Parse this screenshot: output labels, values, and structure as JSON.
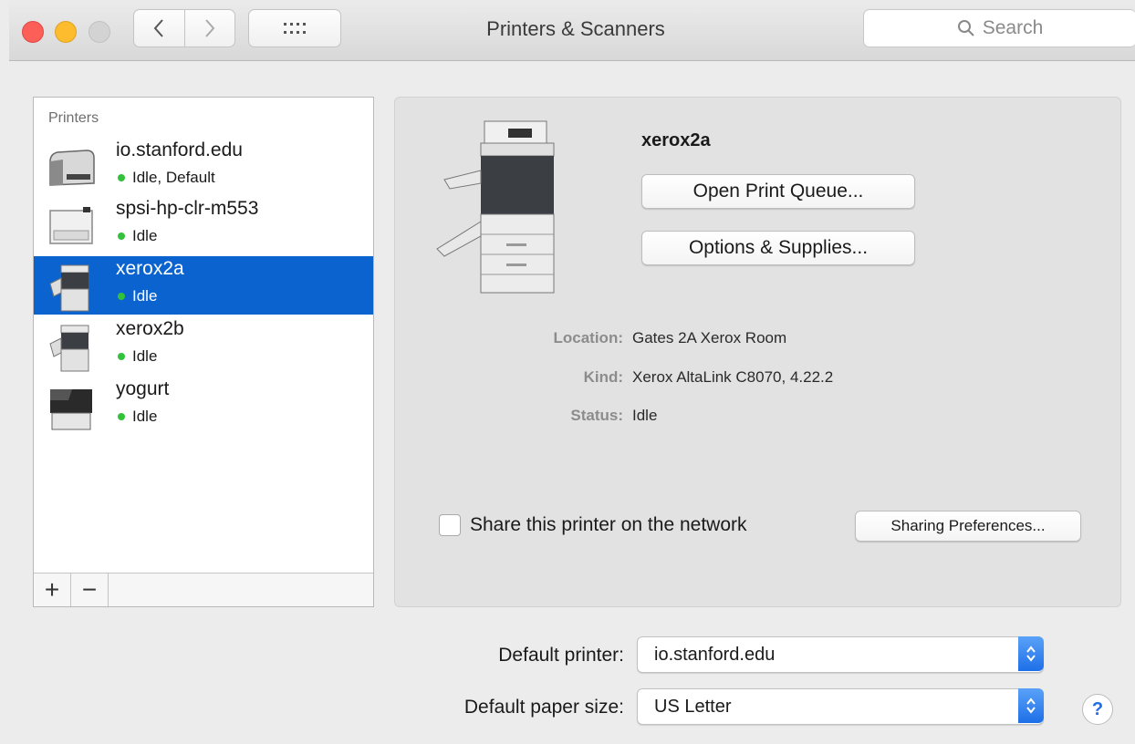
{
  "window": {
    "title": "Printers & Scanners",
    "search_placeholder": "Search"
  },
  "printers_list": {
    "header": "Printers",
    "items": [
      {
        "name": "io.stanford.edu",
        "status": "Idle, Default",
        "icon": "laser-printer-icon"
      },
      {
        "name": "spsi-hp-clr-m553",
        "status": "Idle",
        "icon": "laser-printer-icon"
      },
      {
        "name": "xerox2a",
        "status": "Idle",
        "icon": "copier-printer-icon",
        "selected": true
      },
      {
        "name": "xerox2b",
        "status": "Idle",
        "icon": "copier-printer-icon"
      },
      {
        "name": "yogurt",
        "status": "Idle",
        "icon": "laser-printer-icon"
      }
    ],
    "add_label": "+",
    "remove_label": "−"
  },
  "detail": {
    "name": "xerox2a",
    "open_queue_label": "Open Print Queue...",
    "options_label": "Options & Supplies...",
    "location_label": "Location:",
    "location_value": "Gates 2A Xerox Room",
    "kind_label": "Kind:",
    "kind_value": "Xerox AltaLink C8070, 4.22.2",
    "status_label": "Status:",
    "status_value": "Idle",
    "share_label": "Share this printer on the network",
    "share_checked": false,
    "sharing_prefs_label": "Sharing Preferences..."
  },
  "defaults": {
    "default_printer_label": "Default printer:",
    "default_printer_value": "io.stanford.edu",
    "paper_size_label": "Default paper size:",
    "paper_size_value": "US Letter"
  },
  "help_label": "?",
  "colors": {
    "selection": "#0b63cf",
    "status_dot": "#32c23a",
    "accent": "#1e6fe8"
  }
}
